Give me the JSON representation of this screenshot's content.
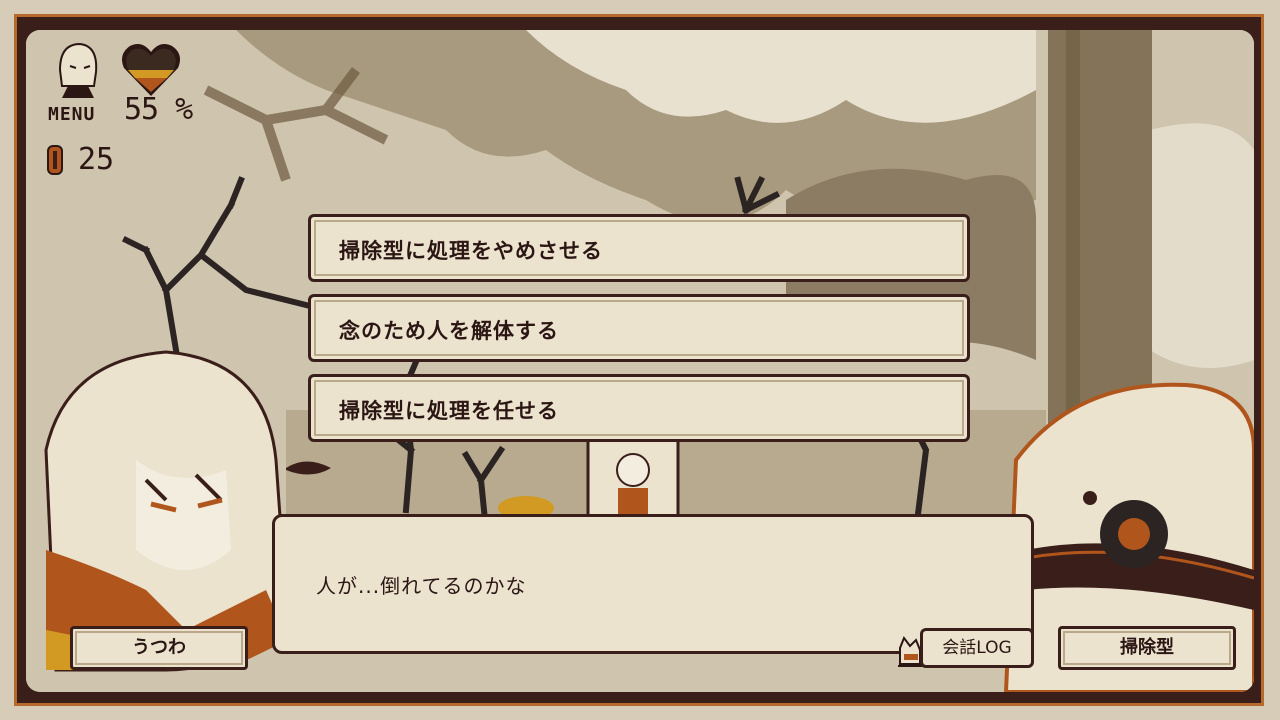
{
  "hud": {
    "menu_label": "MENU",
    "affection_percent": "55 %",
    "coin_count": "25",
    "heart_fill": 0.55
  },
  "choices": [
    {
      "label": "掃除型に処理をやめさせる"
    },
    {
      "label": "念のため人を解体する"
    },
    {
      "label": "掃除型に処理を任せる"
    }
  ],
  "dialog": {
    "text": "人が...倒れてるのかな",
    "left_speaker": "うつわ",
    "right_speaker": "掃除型",
    "log_label": "会話LOG"
  },
  "colors": {
    "frame": "#3a1e1a",
    "frame_border": "#b86a2c",
    "panel": "#ece3cf",
    "text": "#2b1614",
    "accent_orange": "#b0561c",
    "accent_yellow": "#d29a22"
  }
}
